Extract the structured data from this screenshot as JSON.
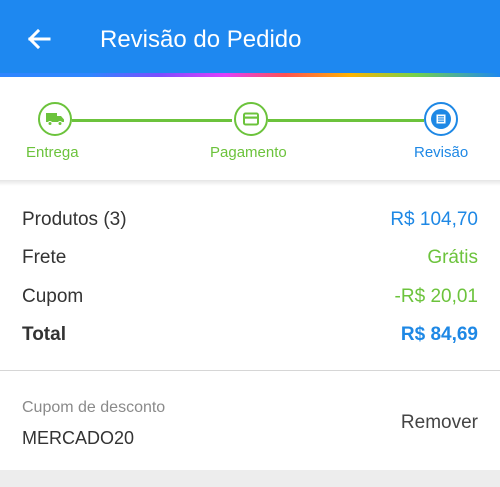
{
  "header": {
    "title": "Revisão do Pedido",
    "back_icon": "arrow-left-icon",
    "background_color": "#1e88f0"
  },
  "stepper": {
    "steps": [
      {
        "label": "Entrega",
        "icon": "truck-icon",
        "state": "done"
      },
      {
        "label": "Pagamento",
        "icon": "credit-card-icon",
        "state": "done"
      },
      {
        "label": "Revisão",
        "icon": "list-icon",
        "state": "active"
      }
    ],
    "done_color": "#6cc33c",
    "active_color": "#1e88e5"
  },
  "summary": {
    "products": {
      "label": "Produtos (3)",
      "value": "R$ 104,70",
      "color": "#1e88e5"
    },
    "shipping": {
      "label": "Frete",
      "value": "Grátis",
      "color": "#6cc33c"
    },
    "coupon": {
      "label": "Cupom",
      "value": "-R$ 20,01",
      "color": "#6cc33c"
    },
    "total": {
      "label": "Total",
      "value": "R$ 84,69",
      "color": "#1e88e5"
    }
  },
  "discount": {
    "caption": "Cupom de desconto",
    "code": "MERCADO20",
    "remove_label": "Remover"
  }
}
